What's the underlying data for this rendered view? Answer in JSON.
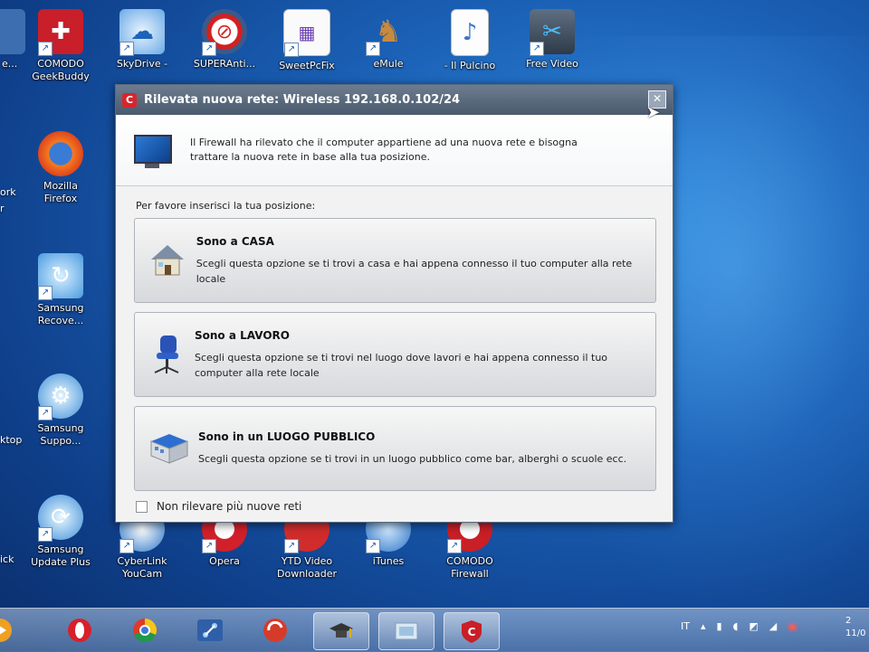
{
  "desktop": {
    "top_row": [
      {
        "label": "e...",
        "icon": "partial-icon"
      },
      {
        "label": "COMODO\nGeekBuddy",
        "icon": "geekbuddy-icon"
      },
      {
        "label": "SkyDrive -",
        "icon": "skydrive-icon"
      },
      {
        "label": "SUPERAnti...",
        "icon": "superantispyware-icon"
      },
      {
        "label": "SweetPcFix",
        "icon": "sweetpcfix-icon"
      },
      {
        "label": "eMule",
        "icon": "emule-icon"
      },
      {
        "label": "- Il Pulcino",
        "icon": "mp3-file-icon"
      },
      {
        "label": "Free Video",
        "icon": "free-video-icon"
      }
    ],
    "left_column": [
      {
        "label": "Mozilla\nFirefox",
        "icon": "firefox-icon"
      },
      {
        "label": "Samsung\nRecove...",
        "icon": "samsung-recovery-icon"
      },
      {
        "label": "Samsung\nSuppo...",
        "icon": "samsung-support-icon"
      },
      {
        "label": "Samsung\nUpdate Plus",
        "icon": "samsung-update-icon"
      }
    ],
    "left_edge_partials": [
      "ork",
      "r",
      "ktop",
      "ick"
    ],
    "bottom_row": [
      {
        "label": "CyberLink\nYouCam",
        "icon": "youcam-icon"
      },
      {
        "label": "Opera",
        "icon": "opera-icon"
      },
      {
        "label": "YTD Video\nDownloader",
        "icon": "ytd-icon"
      },
      {
        "label": "iTunes",
        "icon": "itunes-icon"
      },
      {
        "label": "COMODO\nFirewall",
        "icon": "comodo-firewall-icon"
      }
    ]
  },
  "dialog": {
    "title": "Rilevata nuova rete: Wireless 192.168.0.102/24",
    "close_label": "✕",
    "info_line1": "Il Firewall ha rilevato che il computer appartiene ad una nuova rete e bisogna",
    "info_line2": "trattare la nuova rete in base alla tua posizione.",
    "prompt": "Per favore inserisci la tua posizione:",
    "options": [
      {
        "title": "Sono a CASA",
        "desc": "Scegli questa opzione se ti trovi a casa e hai appena connesso il tuo computer alla rete locale",
        "icon": "house-icon"
      },
      {
        "title": "Sono a LAVORO",
        "desc": "Scegli questa opzione se ti trovi nel luogo dove lavori e hai appena connesso il tuo computer alla rete locale",
        "icon": "office-chair-icon"
      },
      {
        "title": "Sono in un LUOGO PUBBLICO",
        "desc": "Scegli questa opzione se ti trovi in un luogo pubblico come bar, alberghi o scuole ecc.",
        "icon": "public-place-icon"
      }
    ],
    "checkbox_label": "Non rilevare più nuove reti"
  },
  "taskbar": {
    "language": "IT",
    "clock_line1": "2",
    "clock_line2": "11/0"
  }
}
